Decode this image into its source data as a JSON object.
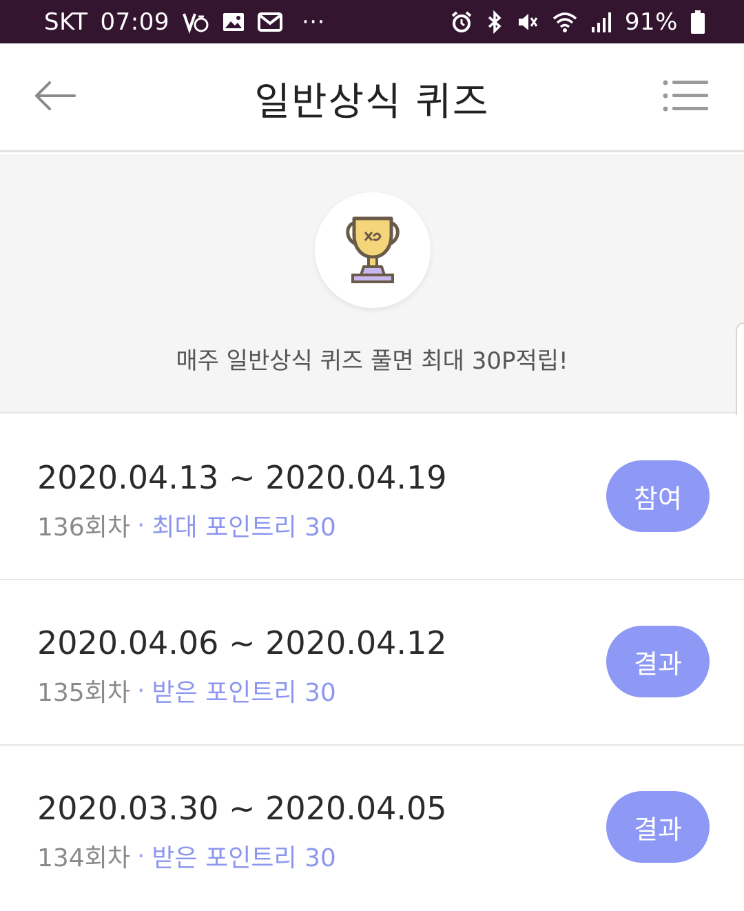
{
  "status_bar": {
    "carrier": "SKT",
    "time": "07:09",
    "more": "···",
    "battery_percent": "91%",
    "icons": [
      "volte-icon",
      "image-icon",
      "mail-icon",
      "alarm-icon",
      "bluetooth-icon",
      "mute-icon",
      "wifi-icon",
      "signal-icon",
      "battery-icon"
    ]
  },
  "header": {
    "title": "일반상식 퀴즈",
    "back_icon": "back-arrow-icon",
    "menu_icon": "list-menu-icon"
  },
  "banner": {
    "icon": "trophy-icon",
    "text": "매주 일반상식 퀴즈 풀면 최대 30P적립!"
  },
  "quizzes": [
    {
      "date_range": "2020.04.13 ~ 2020.04.19",
      "round": "136회차",
      "separator": "·",
      "points": "최대 포인트리 30",
      "button": "참여"
    },
    {
      "date_range": "2020.04.06 ~ 2020.04.12",
      "round": "135회차",
      "separator": "·",
      "points": "받은 포인트리 30",
      "button": "결과"
    },
    {
      "date_range": "2020.03.30 ~ 2020.04.05",
      "round": "134회차",
      "separator": "·",
      "points": "받은 포인트리 30",
      "button": "결과"
    }
  ],
  "colors": {
    "status_bar_bg": "#331530",
    "accent": "#8e98f5",
    "points_text": "#8c96ee"
  }
}
